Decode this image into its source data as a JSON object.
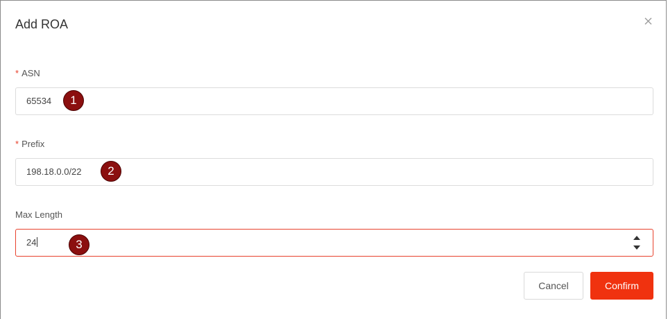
{
  "dialog": {
    "title": "Add ROA",
    "close_icon": "close-icon"
  },
  "fields": {
    "asn": {
      "required_mark": "*",
      "label": "ASN",
      "value": "65534",
      "marker": "1"
    },
    "prefix": {
      "required_mark": "*",
      "label": "Prefix",
      "value": "198.18.0.0/22",
      "marker": "2"
    },
    "max_length": {
      "label": "Max Length",
      "value": "24",
      "marker": "3",
      "spinner_icons": [
        "triangle-up-icon",
        "triangle-down-icon"
      ]
    }
  },
  "footer": {
    "cancel_label": "Cancel",
    "confirm_label": "Confirm"
  },
  "colors": {
    "accent": "#f0320f",
    "required": "#e8412c",
    "marker": "#8b0f0f"
  }
}
